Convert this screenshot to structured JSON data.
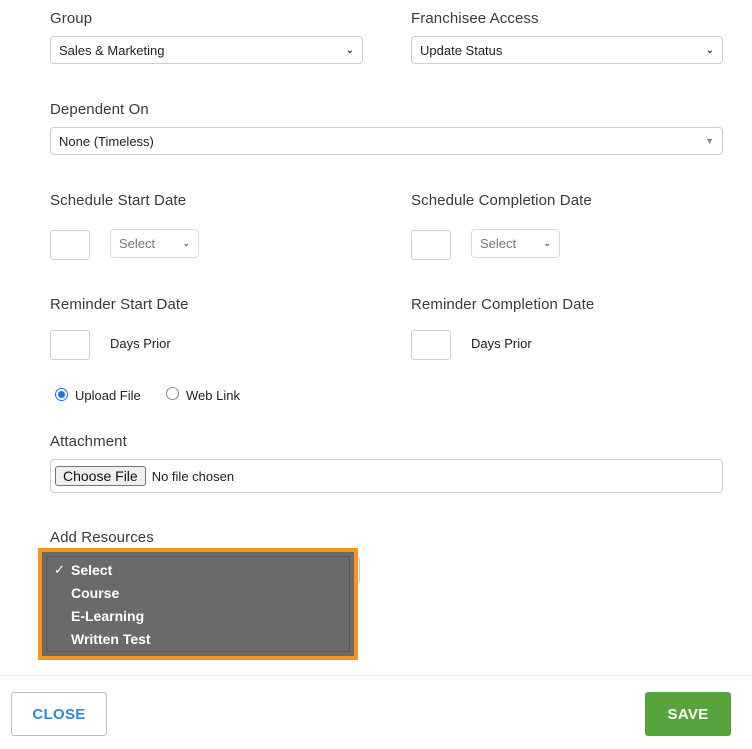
{
  "group": {
    "label": "Group",
    "value": "Sales & Marketing"
  },
  "franchisee_access": {
    "label": "Franchisee Access",
    "value": "Update Status"
  },
  "dependent_on": {
    "label": "Dependent On",
    "value": "None (Timeless)"
  },
  "schedule_start": {
    "label": "Schedule Start Date",
    "select_value": "Select"
  },
  "schedule_completion": {
    "label": "Schedule Completion Date",
    "select_value": "Select"
  },
  "reminder_start": {
    "label": "Reminder Start Date",
    "suffix": "Days Prior"
  },
  "reminder_completion": {
    "label": "Reminder Completion Date",
    "suffix": "Days Prior"
  },
  "source_type": {
    "options": [
      "Upload File",
      "Web Link"
    ],
    "selected": "Upload File"
  },
  "attachment": {
    "label": "Attachment",
    "button_label": "Choose File",
    "status": "No file chosen"
  },
  "add_resources": {
    "label": "Add Resources",
    "selected": "Select",
    "check_mark": "✓",
    "options": [
      "Select",
      "Course",
      "E-Learning",
      "Written Test"
    ]
  },
  "footer": {
    "close_label": "CLOSE",
    "save_label": "SAVE"
  },
  "colors": {
    "highlight": "#f7941d",
    "save": "#57a43f",
    "close_text": "#2f8bd6",
    "radio": "#1a73e8"
  }
}
